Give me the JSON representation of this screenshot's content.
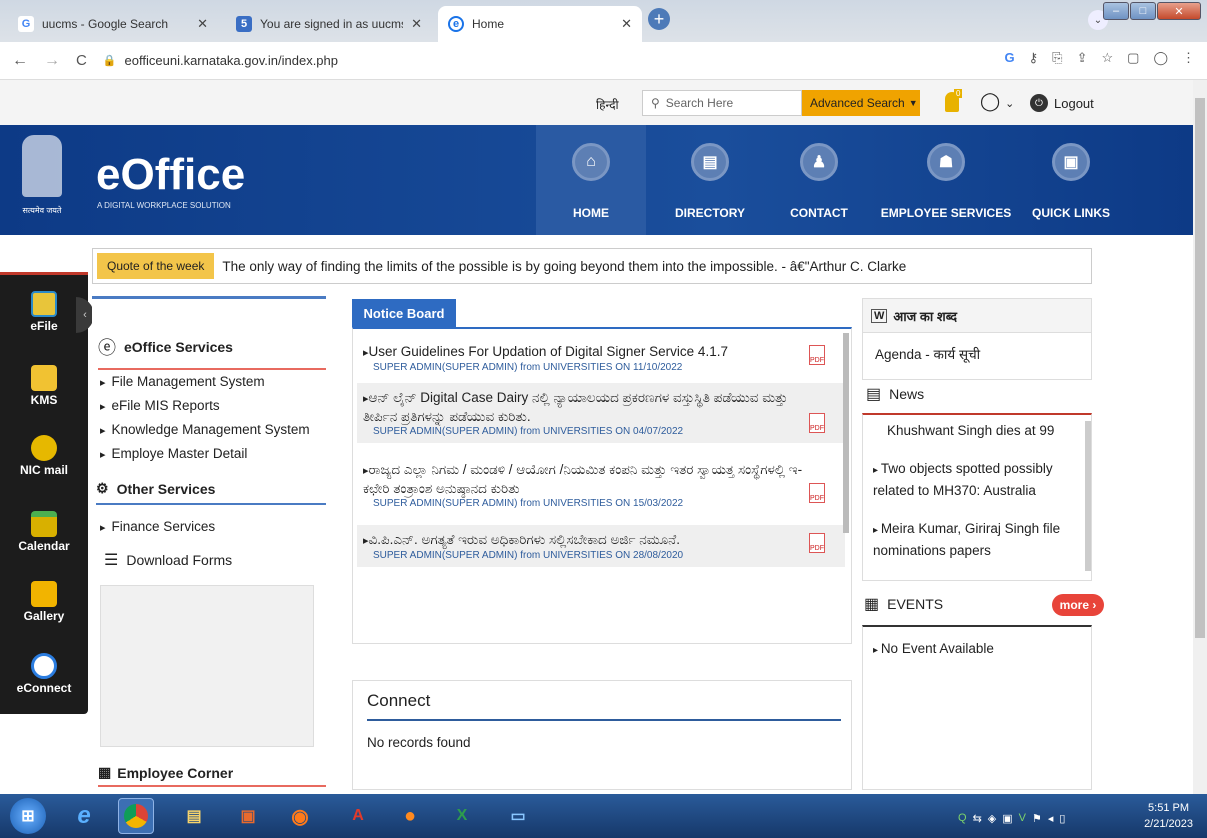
{
  "browser": {
    "tabs": [
      {
        "title": "uucms - Google Search",
        "favicon": "G"
      },
      {
        "title": "You are signed in as uucms",
        "favicon": "5"
      },
      {
        "title": "Home",
        "favicon": "e"
      }
    ],
    "url": "eofficeuni.karnataka.gov.in/index.php"
  },
  "topbar": {
    "language": "हिन्दी",
    "search_placeholder": "Search Here",
    "advanced_search": "Advanced Search",
    "bell_count": "0",
    "logout": "Logout"
  },
  "header": {
    "logo": "eOffice",
    "tagline": "A DIGITAL WORKPLACE SOLUTION",
    "emblem_text": "सत्यमेव जयते",
    "nav": [
      "HOME",
      "DIRECTORY",
      "CONTACT",
      "EMPLOYEE SERVICES",
      "QUICK LINKS"
    ]
  },
  "quote": {
    "label": "Quote of the week",
    "text": "The only way of finding the limits of the possible is by going beyond them into the impossible. - â€\"Arthur C. Clarke"
  },
  "dock": [
    "eFile",
    "KMS",
    "NIC mail",
    "Calendar",
    "Gallery",
    "eConnect"
  ],
  "left_panel": {
    "eoffice_services_title": "eOffice Services",
    "eoffice_services": [
      "File Management System",
      "eFile MIS Reports",
      "Knowledge Management System",
      "Employe Master Detail"
    ],
    "other_services_title": "Other Services",
    "other_services": [
      "Finance Services"
    ],
    "download_forms": "Download Forms",
    "employee_corner": "Employee Corner"
  },
  "notice_board": {
    "title": "Notice Board",
    "items": [
      {
        "title": "User Guidelines For Updation of Digital Signer Service 4.1.7",
        "meta": "SUPER ADMIN(SUPER ADMIN) from UNIVERSITIES ON 11/10/2022"
      },
      {
        "title": "ಆನ್ ಲೈನ್ Digital Case Dairy ನಲ್ಲಿ ನ್ಯಾಯಾಲಯದ ಪ್ರಕರಣಗಳ ವಸ್ತುಸ್ಥಿತಿ ಪಡೆಯುವ ಮತ್ತು ತೀರ್ಪಿನ ಪ್ರತಿಗಳನ್ನು ಪಡೆಯುವ ಕುರಿತು.",
        "meta": "SUPER ADMIN(SUPER ADMIN) from UNIVERSITIES ON 04/07/2022"
      },
      {
        "title": "ರಾಜ್ಯದ ಎಲ್ಲಾ ನಿಗಮ / ಮಂಡಳಿ / ಆಯೋಗ /ನಿಯಮಿತ ಕಂಪನಿ ಮತ್ತು ಇತರ ಸ್ವಾಯತ್ತ ಸಂಸ್ಥೆಗಳಲ್ಲಿ ಇ-ಕಛೇರಿ ತಂತ್ರಾಂಶ ಅನುಷ್ಠಾನದ ಕುರಿತು",
        "meta": "SUPER ADMIN(SUPER ADMIN) from UNIVERSITIES ON 15/03/2022"
      },
      {
        "title": "ವಿ.ಪಿ.ಎನ್. ಅಗತ್ಯತೆ ಇರುವ ಅಧಿಕಾರಿಗಳು ಸಲ್ಲಿಸಬೇಕಾದ ಅರ್ಜಿ ನಮೂನೆ.",
        "meta": "SUPER ADMIN(SUPER ADMIN) from UNIVERSITIES ON 28/08/2020"
      }
    ]
  },
  "connect": {
    "title": "Connect",
    "empty": "No records found"
  },
  "right_panel": {
    "word_title": "आज का शब्द",
    "word_text": "Agenda - कार्य सूची",
    "news_title": "News",
    "news": [
      "Khushwant Singh dies at 99",
      "Two objects spotted possibly related to MH370: Australia",
      "Meira Kumar, Giriraj Singh file nominations papers"
    ],
    "events_title": "EVENTS",
    "more": "more ›",
    "events_empty": "No Event Available"
  },
  "taskbar": {
    "time": "5:51 PM",
    "date": "2/21/2023"
  }
}
